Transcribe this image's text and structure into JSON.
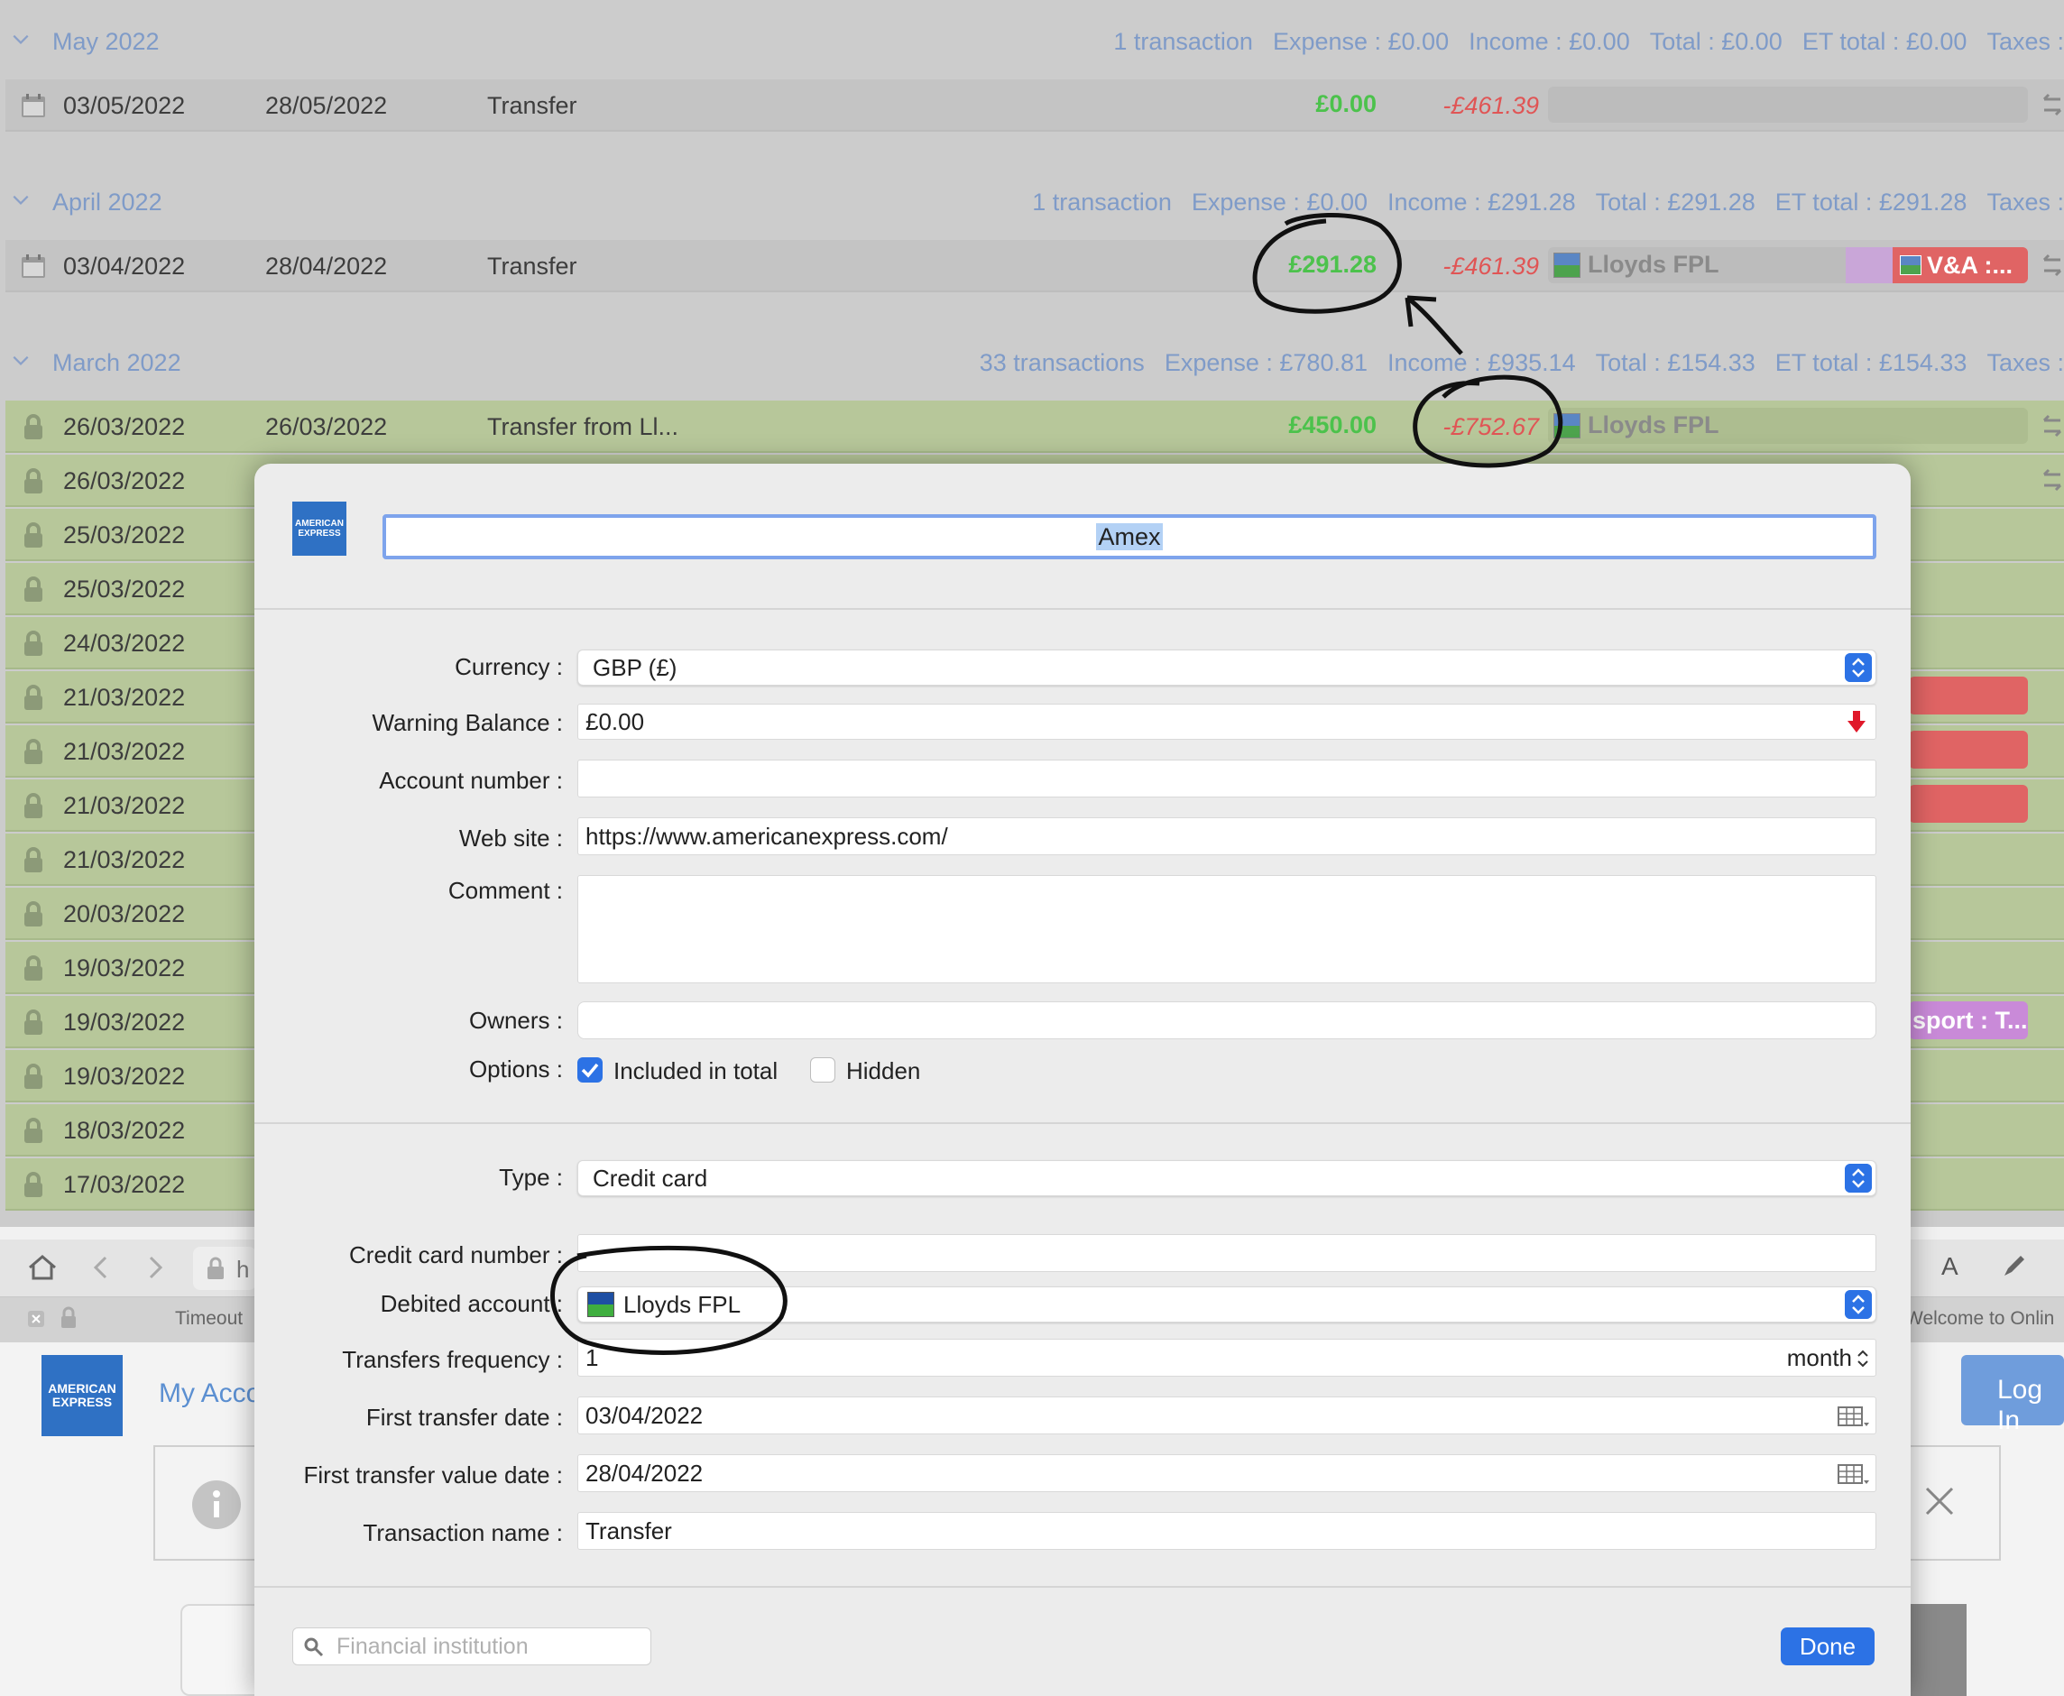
{
  "groups": [
    {
      "month": "May 2022",
      "count": "1 transaction",
      "expense": "Expense : £0.00",
      "income": "Income : £0.00",
      "total": "Total : £0.00",
      "et_total": "ET total : £0.00",
      "taxes": "Taxes :"
    },
    {
      "month": "April 2022",
      "count": "1 transaction",
      "expense": "Expense : £0.00",
      "income": "Income : £291.28",
      "total": "Total : £291.28",
      "et_total": "ET total : £291.28",
      "taxes": "Taxes :"
    },
    {
      "month": "March 2022",
      "count": "33 transactions",
      "expense": "Expense : £780.81",
      "income": "Income : £935.14",
      "total": "Total : £154.33",
      "et_total": "ET total : £154.33",
      "taxes": "Taxes :"
    }
  ],
  "scheduled_rows": [
    {
      "date": "03/05/2022",
      "value_date": "28/05/2022",
      "desc": "Transfer",
      "amount": "£0.00",
      "balance": "-£461.39"
    },
    {
      "date": "03/04/2022",
      "value_date": "28/04/2022",
      "desc": "Transfer",
      "amount": "£291.28",
      "balance": "-£461.39",
      "account": "Lloyds FPL",
      "tag": "V&A :..."
    }
  ],
  "march_rows": [
    {
      "date": "26/03/2022",
      "value_date": "26/03/2022",
      "desc": "Transfer from Ll...",
      "amount": "£450.00",
      "balance": "-£752.67",
      "account": "Lloyds FPL"
    },
    {
      "date": "26/03/2022"
    },
    {
      "date": "25/03/2022"
    },
    {
      "date": "25/03/2022"
    },
    {
      "date": "24/03/2022"
    },
    {
      "date": "21/03/2022"
    },
    {
      "date": "21/03/2022"
    },
    {
      "date": "21/03/2022"
    },
    {
      "date": "21/03/2022"
    },
    {
      "date": "20/03/2022"
    },
    {
      "date": "19/03/2022"
    },
    {
      "date": "19/03/2022",
      "tag": "sport : T..."
    },
    {
      "date": "19/03/2022"
    },
    {
      "date": "18/03/2022"
    },
    {
      "date": "17/03/2022"
    }
  ],
  "browser": {
    "tab_left": "Timeout",
    "tab_right": "Welcome to Onlin",
    "my_account": "My Acco",
    "login": "Log In",
    "url_fragment": "h",
    "font_btn": "A"
  },
  "dialog": {
    "account_name": "Amex",
    "labels": {
      "currency": "Currency :",
      "warning_balance": "Warning Balance :",
      "account_number": "Account number :",
      "web_site": "Web site :",
      "comment": "Comment :",
      "owners": "Owners :",
      "options": "Options :",
      "type": "Type :",
      "credit_card_number": "Credit card number :",
      "debited_account": "Debited account :",
      "transfers_frequency": "Transfers frequency :",
      "first_transfer_date": "First transfer date :",
      "first_transfer_value_date": "First transfer value date :",
      "transaction_name": "Transaction name :"
    },
    "values": {
      "currency": "GBP (£)",
      "warning_balance": "£0.00",
      "account_number": "",
      "web_site": "https://www.americanexpress.com/",
      "comment": "",
      "owners": "",
      "type": "Credit card",
      "credit_card_number": "",
      "debited_account": "Lloyds FPL",
      "transfers_frequency": "1",
      "frequency_unit": "month",
      "first_transfer_date": "03/04/2022",
      "first_transfer_value_date": "28/04/2022",
      "transaction_name": "Transfer"
    },
    "options": {
      "included_in_total": "Included in total",
      "included_checked": true,
      "hidden": "Hidden",
      "hidden_checked": false
    },
    "search_placeholder": "Financial institution",
    "done_label": "Done"
  },
  "colors": {
    "accent": "#2c72e5",
    "income_green": "#4cc24c",
    "negative_red": "#e05555",
    "header_blue": "#7f9bc8",
    "reconciled_row": "#b7c79a"
  }
}
